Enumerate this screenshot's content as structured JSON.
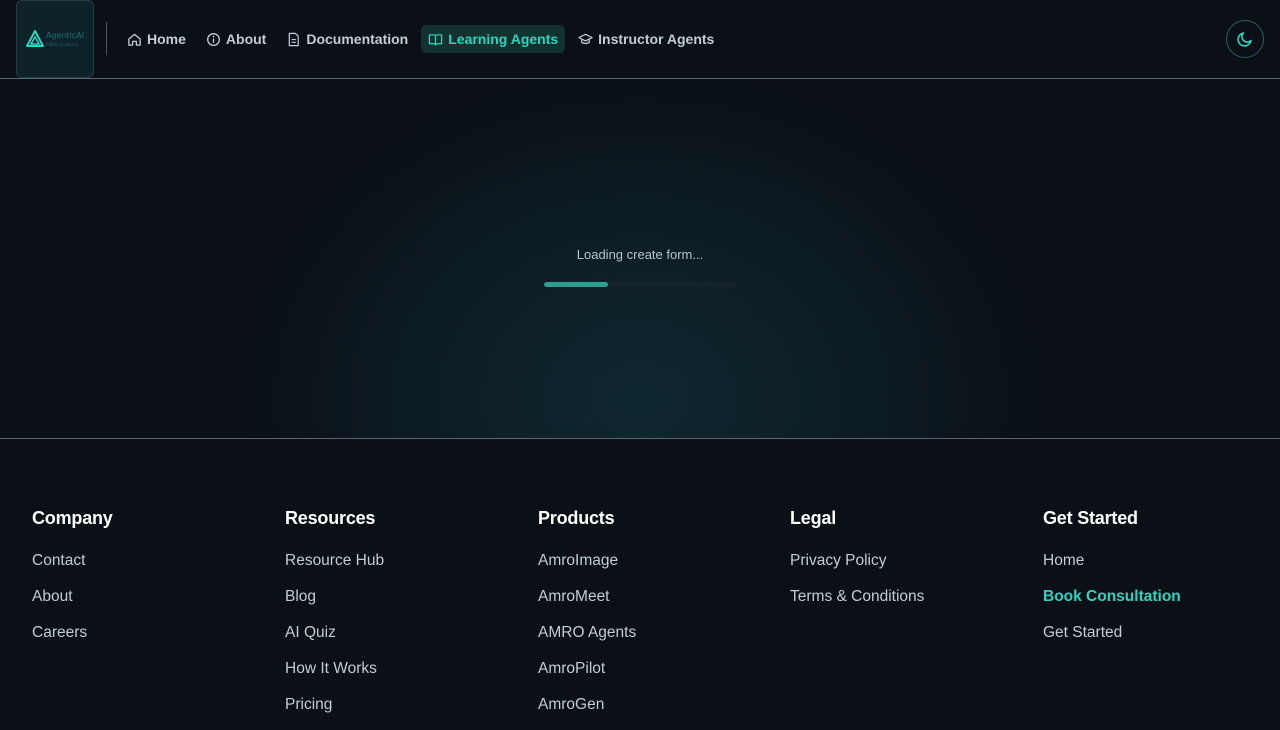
{
  "header": {
    "logo": {
      "name": "AgenticAI",
      "sub": "AMRO Academy"
    },
    "nav": [
      {
        "label": "Home",
        "icon": "home-icon",
        "active": false
      },
      {
        "label": "About",
        "icon": "info-icon",
        "active": false
      },
      {
        "label": "Documentation",
        "icon": "document-icon",
        "active": false
      },
      {
        "label": "Learning Agents",
        "icon": "book-icon",
        "active": true
      },
      {
        "label": "Instructor Agents",
        "icon": "graduation-cap-icon",
        "active": false
      }
    ],
    "theme_toggle_icon": "moon-icon"
  },
  "main": {
    "loading_text": "Loading create form...",
    "progress": 0.33
  },
  "footer": {
    "columns": [
      {
        "title": "Company",
        "links": [
          "Contact",
          "About",
          "Careers"
        ]
      },
      {
        "title": "Resources",
        "links": [
          "Resource Hub",
          "Blog",
          "AI Quiz",
          "How It Works",
          "Pricing"
        ]
      },
      {
        "title": "Products",
        "links": [
          "AmroImage",
          "AmroMeet",
          "AMRO Agents",
          "AmroPilot",
          "AmroGen"
        ]
      },
      {
        "title": "Legal",
        "links": [
          "Privacy Policy",
          "Terms & Conditions"
        ]
      },
      {
        "title": "Get Started",
        "links": [
          "Home",
          "Book Consultation",
          "Get Started"
        ]
      }
    ],
    "accent_link": "Book Consultation"
  },
  "colors": {
    "accent": "#2dd4bf",
    "background": "#0b1017",
    "progress": "#2a9d94"
  }
}
